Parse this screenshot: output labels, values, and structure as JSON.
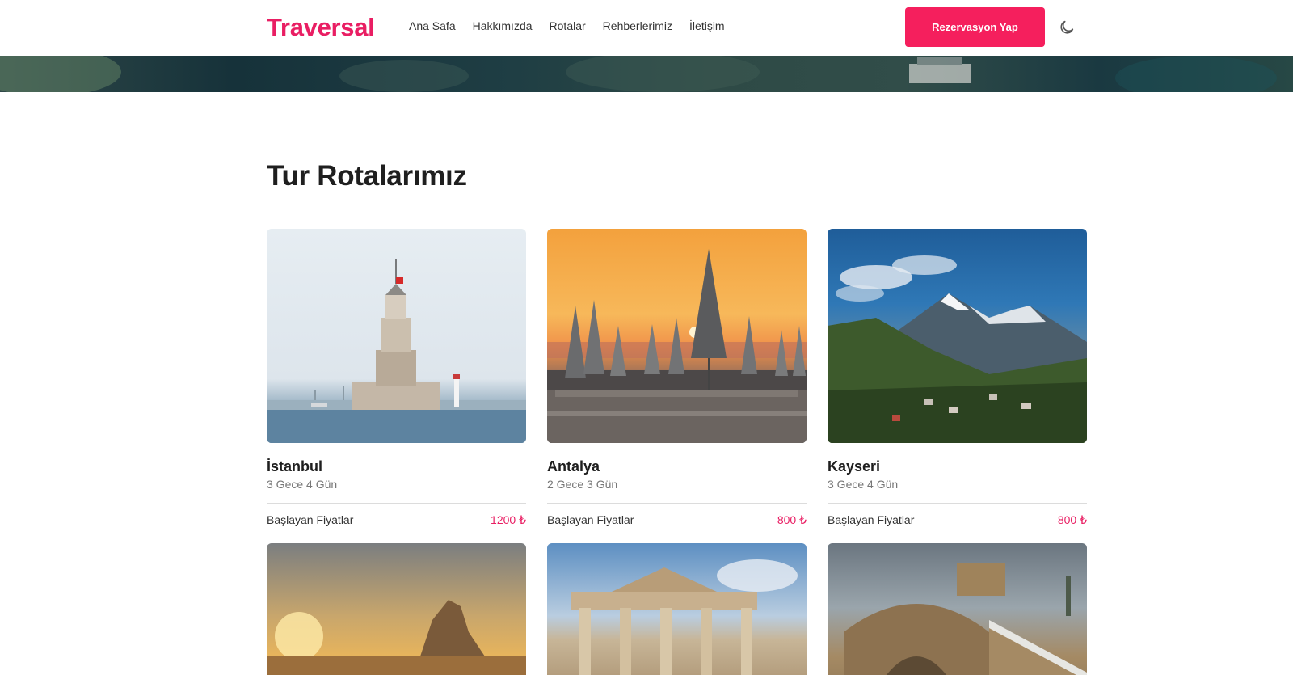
{
  "header": {
    "logo": "Traversal",
    "nav": [
      "Ana Safa",
      "Hakkımızda",
      "Rotalar",
      "Rehberlerimiz",
      "İletişim"
    ],
    "cta": "Rezervasyon Yap",
    "theme_icon": "moon-icon"
  },
  "section": {
    "title": "Tur Rotalarımız"
  },
  "tours": [
    {
      "name": "İstanbul",
      "duration": "3 Gece 4 Gün",
      "price_label": "Başlayan Fiyatlar",
      "price": "1200 ₺"
    },
    {
      "name": "Antalya",
      "duration": "2 Gece 3 Gün",
      "price_label": "Başlayan Fiyatlar",
      "price": "800 ₺"
    },
    {
      "name": "Kayseri",
      "duration": "3 Gece 4 Gün",
      "price_label": "Başlayan Fiyatlar",
      "price": "800 ₺"
    }
  ],
  "colors": {
    "brand": "#e91e63",
    "cta_bg": "#f51f5d",
    "text": "#1f1f1f"
  }
}
